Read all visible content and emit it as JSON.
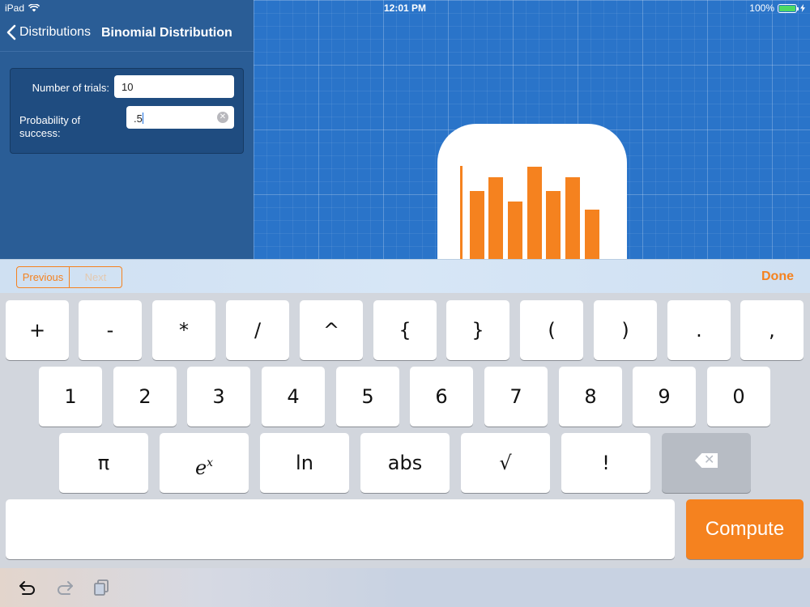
{
  "status": {
    "device": "iPad",
    "time": "12:01 PM",
    "battery": "100%",
    "colors": {
      "battery": "#4cd964"
    }
  },
  "nav": {
    "back_label": "Distributions",
    "title": "Binomial Distribution"
  },
  "form": {
    "trials_label": "Number of trials:",
    "trials_value": "10",
    "prob_label": "Probability of success:",
    "prob_value": ".5"
  },
  "accessory": {
    "previous_label": "Previous",
    "next_label": "Next",
    "done_label": "Done"
  },
  "keyboard": {
    "row1": [
      "+",
      "-",
      "*",
      "/",
      "^",
      "{",
      "}",
      "(",
      ")",
      ".",
      ","
    ],
    "row2": [
      "1",
      "2",
      "3",
      "4",
      "5",
      "6",
      "7",
      "8",
      "9",
      "0"
    ],
    "row3": [
      "π",
      "e^x",
      "ln",
      "abs",
      "√",
      "!",
      "backspace"
    ],
    "compute_label": "Compute"
  },
  "toolbar": {
    "icons": [
      "undo-icon",
      "redo-icon",
      "copy-icon"
    ]
  },
  "colors": {
    "accent": "#f5821f",
    "panel": "#2a5d96",
    "grid": "#2a74c9"
  }
}
